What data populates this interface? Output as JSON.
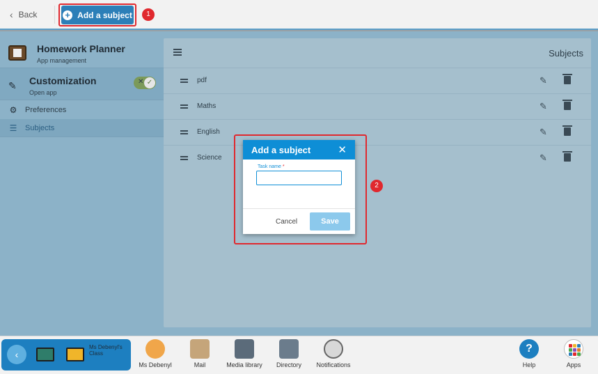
{
  "topbar": {
    "back_label": "Back",
    "add_subject_label": "Add a subject",
    "step1_badge": "1"
  },
  "sidebar": {
    "app_title": "Homework Planner",
    "app_subtitle": "App management",
    "customization_title": "Customization",
    "customization_subtitle": "Open app",
    "toggle_state": "on",
    "items": [
      {
        "label": "Preferences",
        "icon": "gear-icon"
      },
      {
        "label": "Subjects",
        "icon": "list-icon"
      }
    ]
  },
  "panel": {
    "title": "Subjects",
    "rows": [
      {
        "name": "pdf"
      },
      {
        "name": "Maths"
      },
      {
        "name": "English"
      },
      {
        "name": "Science"
      }
    ]
  },
  "dialog": {
    "title": "Add a subject",
    "field_label": "Task name",
    "field_required_mark": "*",
    "field_value": "",
    "cancel_label": "Cancel",
    "save_label": "Save",
    "step2_badge": "2"
  },
  "dock": {
    "back_icon": "chevron-left-icon",
    "class_name": "Ms Debenyl's Class",
    "items": [
      {
        "label": "Ms Debenyl"
      },
      {
        "label": "Mail"
      },
      {
        "label": "Media library"
      },
      {
        "label": "Directory"
      },
      {
        "label": "Notifications"
      },
      {
        "label": "Help"
      },
      {
        "label": "Apps"
      }
    ]
  },
  "colors": {
    "accent": "#0e8ed6",
    "highlight": "#e0282e",
    "add_button": "#2c7fb8"
  }
}
